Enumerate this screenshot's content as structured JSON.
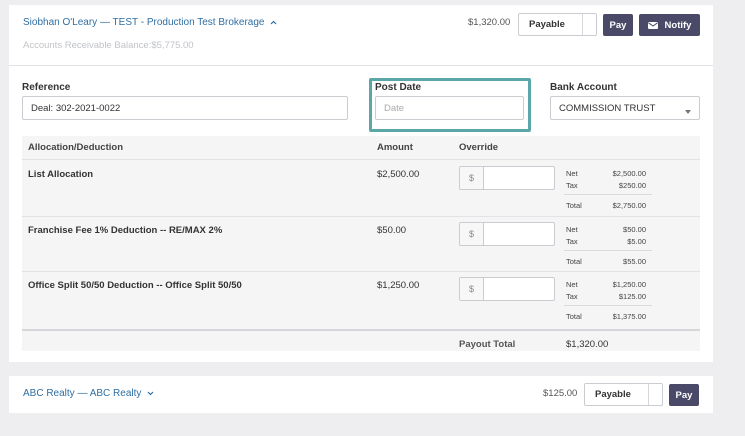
{
  "card1": {
    "title_link": "Siobhan O'Leary — TEST - Production Test Brokerage",
    "ar_label": "Accounts Receivable Balance:",
    "ar_value": "$5,775.00",
    "amount": "$1,320.00",
    "status_select": "Payable",
    "pay_label": "Pay",
    "notify_label": "Notify",
    "reference_label": "Reference",
    "reference_value": "Deal: 302-2021-0022",
    "post_date_label": "Post Date",
    "post_date_placeholder": "Date",
    "bank_account_label": "Bank Account",
    "bank_account_value": "COMMISSION TRUST",
    "table": {
      "headers": {
        "allocation": "Allocation/Deduction",
        "amount": "Amount",
        "override": "Override"
      },
      "rows": [
        {
          "name": "List Allocation",
          "amount": "$2,500.00",
          "prefix": "$",
          "net_label": "Net",
          "net": "$2,500.00",
          "tax_label": "Tax",
          "tax": "$250.00",
          "total_label": "Total",
          "total": "$2,750.00"
        },
        {
          "name": "Franchise Fee 1% Deduction -- RE/MAX 2%",
          "amount": "$50.00",
          "prefix": "$",
          "net_label": "Net",
          "net": "$50.00",
          "tax_label": "Tax",
          "tax": "$5.00",
          "total_label": "Total",
          "total": "$55.00"
        },
        {
          "name": "Office Split 50/50 Deduction -- Office Split 50/50",
          "amount": "$1,250.00",
          "prefix": "$",
          "net_label": "Net",
          "net": "$1,250.00",
          "tax_label": "Tax",
          "tax": "$125.00",
          "total_label": "Total",
          "total": "$1,375.00"
        }
      ],
      "payout_label": "Payout Total",
      "payout_value": "$1,320.00"
    }
  },
  "card2": {
    "title_link": "ABC Realty — ABC Realty",
    "amount": "$125.00",
    "status_select": "Payable",
    "pay_label": "Pay"
  },
  "colors": {
    "accent_border": "#5aa6a8",
    "dark_button": "#4a4a68",
    "link": "#2f6fa3"
  },
  "icons": {
    "chevron_up": "chevron-up-icon",
    "chevron_down": "chevron-down-icon",
    "mail": "mail-icon",
    "caret": "caret-down-icon"
  }
}
